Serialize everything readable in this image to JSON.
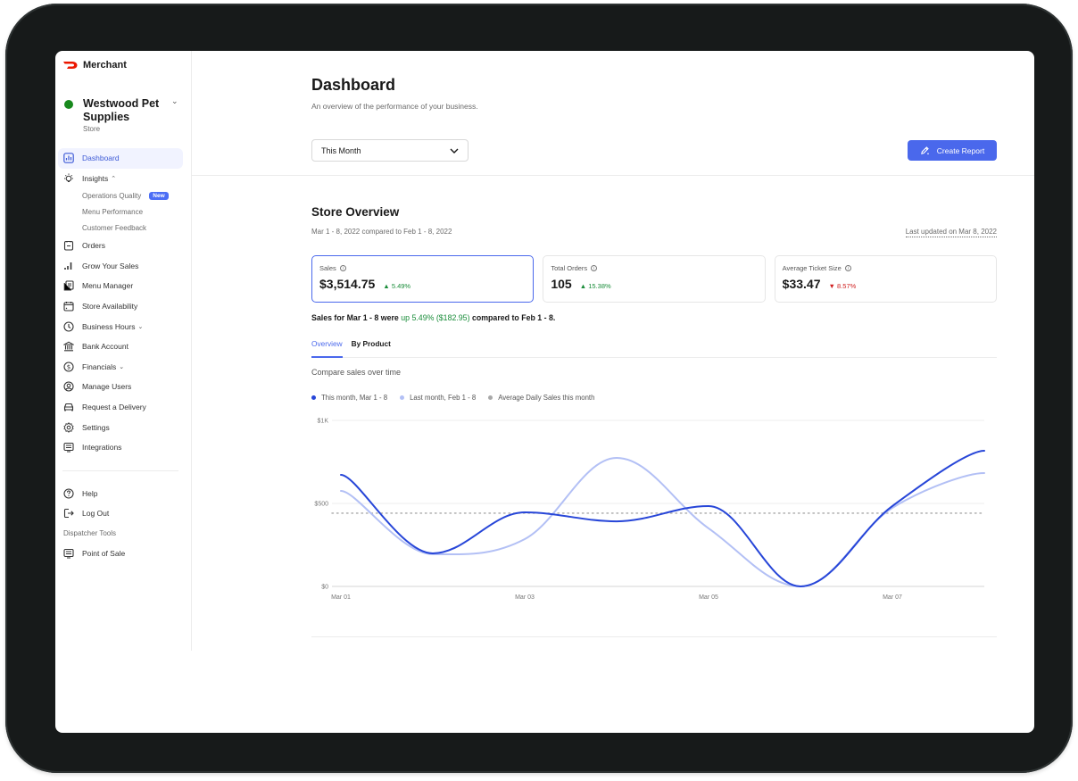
{
  "brand": {
    "name": "Merchant",
    "logo_color": "#eb1700"
  },
  "store": {
    "name": "Westwood Pet Supplies",
    "type": "Store",
    "status_color": "#18891d"
  },
  "sidebar": {
    "items": [
      {
        "label": "Dashboard",
        "icon": "chart-icon",
        "active": true
      },
      {
        "label": "Insights",
        "icon": "lightbulb-icon",
        "expanded": true,
        "chevron": "^"
      },
      {
        "label": "Orders",
        "icon": "orders-icon"
      },
      {
        "label": "Grow Your Sales",
        "icon": "bars-icon"
      },
      {
        "label": "Menu Manager",
        "icon": "menu-icon"
      },
      {
        "label": "Store Availability",
        "icon": "calendar-icon"
      },
      {
        "label": "Business Hours",
        "icon": "clock-icon",
        "chevron": "v"
      },
      {
        "label": "Bank Account",
        "icon": "bank-icon"
      },
      {
        "label": "Financials",
        "icon": "dollar-icon",
        "chevron": "v"
      },
      {
        "label": "Manage Users",
        "icon": "user-icon"
      },
      {
        "label": "Request a Delivery",
        "icon": "car-icon"
      },
      {
        "label": "Settings",
        "icon": "gear-icon"
      },
      {
        "label": "Integrations",
        "icon": "integrations-icon"
      }
    ],
    "insights_sub": [
      {
        "label": "Operations Quality",
        "badge": "New"
      },
      {
        "label": "Menu Performance"
      },
      {
        "label": "Customer Feedback"
      }
    ],
    "footer": [
      {
        "label": "Help",
        "icon": "help-icon"
      },
      {
        "label": "Log Out",
        "icon": "logout-icon"
      }
    ],
    "section_label": "Dispatcher Tools",
    "tools": [
      {
        "label": "Point of Sale",
        "icon": "pos-icon"
      }
    ]
  },
  "header": {
    "title": "Dashboard",
    "subtitle": "An overview of the performance of your business.",
    "period": "This Month",
    "create_report": "Create Report",
    "accent": "#4a68ec"
  },
  "overview": {
    "title": "Store Overview",
    "range": "Mar 1 - 8, 2022 compared to Feb 1 - 8, 2022",
    "updated": "Last updated on Mar 8, 2022",
    "cards": [
      {
        "label": "Sales",
        "value": "$3,514.75",
        "delta": "5.49%",
        "direction": "up",
        "selected": true
      },
      {
        "label": "Total Orders",
        "value": "105",
        "delta": "15.38%",
        "direction": "up"
      },
      {
        "label": "Average Ticket Size",
        "value": "$33.47",
        "delta": "8.57%",
        "direction": "down"
      }
    ],
    "summary": {
      "prefix": "Sales for Mar 1 - 8 were ",
      "highlight": "up 5.49% ($182.95)",
      "suffix": " compared to Feb 1 - 8."
    },
    "tabs": [
      {
        "label": "Overview",
        "active": true
      },
      {
        "label": "By Product"
      }
    ],
    "compare_label": "Compare sales over time"
  },
  "chart_data": {
    "type": "line",
    "title": "Compare sales over time",
    "x": [
      "Mar 01",
      "Mar 02",
      "Mar 03",
      "Mar 04",
      "Mar 05",
      "Mar 06",
      "Mar 07",
      "Mar 08"
    ],
    "x_tick_labels": [
      "Mar 01",
      "Mar 03",
      "Mar 05",
      "Mar 07"
    ],
    "y_tick_labels": [
      "$0",
      "$500",
      "$1K"
    ],
    "y_ticks": [
      0,
      500,
      1000
    ],
    "ylim": [
      0,
      1000
    ],
    "grid": true,
    "legend_position": "top-left",
    "series": [
      {
        "name": "This month, Mar 1 - 8",
        "color": "#2746d8",
        "values": [
          672,
          199,
          446,
          392,
          484,
          0,
          484,
          817
        ]
      },
      {
        "name": "Last month, Feb 1 - 8",
        "color": "#b3c0f5",
        "values": [
          575,
          194,
          285,
          774,
          350,
          0,
          473,
          683
        ]
      },
      {
        "name": "Average Daily Sales this month",
        "color": "#a8a8a8",
        "style": "dotted",
        "values": [
          441,
          441,
          441,
          441,
          441,
          441,
          441,
          441
        ]
      }
    ]
  }
}
